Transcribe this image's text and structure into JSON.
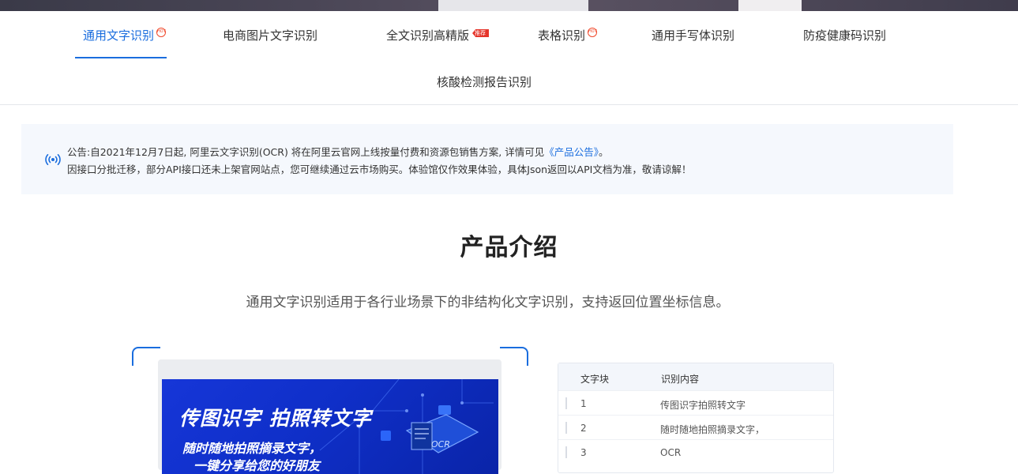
{
  "tabs": [
    {
      "label": "通用文字识别",
      "badge": "hot",
      "badge_text": "HOT",
      "active": true
    },
    {
      "label": "电商图片文字识别",
      "badge": null,
      "active": false
    },
    {
      "label": "全文识别高精版",
      "badge": "recommend",
      "badge_text": "推荐",
      "active": false
    },
    {
      "label": "表格识别",
      "badge": "hot",
      "badge_text": "HOT",
      "active": false
    },
    {
      "label": "通用手写体识别",
      "badge": null,
      "active": false
    },
    {
      "label": "防疫健康码识别",
      "badge": null,
      "active": false
    },
    {
      "label": "核酸检测报告识别",
      "badge": null,
      "active": false
    }
  ],
  "notice": {
    "line1_prefix": "公告:自2021年12月7日起, 阿里云文字识别(OCR) 将在阿里云官网上线按量付费和资源包销售方案, 详情可见",
    "line1_link": "《产品公告》",
    "line1_suffix": "。",
    "line2": "因接口分批迁移，部分API接口还未上架官网站点，您可继续通过云市场购买。体验馆仅作效果体验，具体Json返回以API文档为准，敬请谅解！"
  },
  "intro": {
    "title": "产品介绍",
    "description": "通用文字识别适用于各行业场景下的非结构化文字识别，支持返回位置坐标信息。"
  },
  "demo_image": {
    "title": "传图识字 拍照转文字",
    "line1": "随时随地拍照摘录文字，",
    "line2": "一键分享给您的好朋友",
    "ocr_label": "OCR"
  },
  "result_table": {
    "headers": [
      "文字块",
      "识别内容"
    ],
    "rows": [
      {
        "index": "1",
        "content": "传图识字拍照转文字"
      },
      {
        "index": "2",
        "content": "随时随地拍照摘录文字，"
      },
      {
        "index": "3",
        "content": "OCR"
      }
    ]
  },
  "colors": {
    "accent": "#1a6dde",
    "badge_red": "#e5352b",
    "notice_bg": "#f5f8fd",
    "banner_blue": "#1636d8"
  }
}
